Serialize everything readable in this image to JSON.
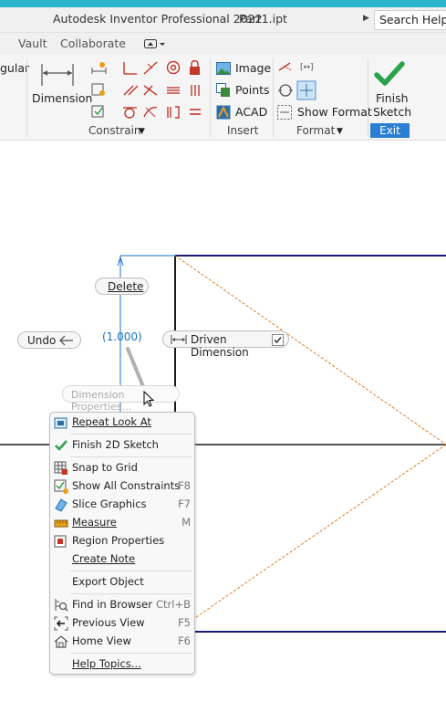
{
  "window": {
    "app_title": "Autodesk Inventor Professional 2022",
    "file_name": "Part1.ipt",
    "search_text": "Search Help &"
  },
  "tabs": [
    "Vault",
    "Collaborate"
  ],
  "ribbon": {
    "partial_label": "gular",
    "dimension_label": "Dimension",
    "constrain_label": "Constrain",
    "insert": {
      "image": "Image",
      "points": "Points",
      "acad": "ACAD",
      "label": "Insert"
    },
    "format": {
      "show_format": "Show Format",
      "label": "Format"
    },
    "exit": {
      "finish_line1": "Finish",
      "finish_line2": "Sketch",
      "label": "Exit"
    }
  },
  "canvas": {
    "delete_label": "Delete",
    "undo_label": "Undo",
    "dimension_value": "(1.000)",
    "driven_dimension_label": "Driven Dimension",
    "dimension_properties_label": "Dimension Properties...",
    "colors": {
      "accent": "#1a73c8",
      "sketch_line": "#1a1a1a",
      "geometry": "#1a1a7a",
      "construction": "#e07b1a"
    }
  },
  "context_menu": {
    "items": [
      {
        "label": "Repeat Look At",
        "shortcut": "",
        "icon": "look-at-icon"
      },
      {
        "label": "Finish 2D Sketch",
        "shortcut": "",
        "icon": "checkmark-icon"
      },
      {
        "label": "Snap to Grid",
        "shortcut": "",
        "icon": "grid-icon"
      },
      {
        "label": "Show All Constraints",
        "shortcut": "F8",
        "icon": "constraints-icon"
      },
      {
        "label": "Slice Graphics",
        "shortcut": "F7",
        "icon": "slice-icon"
      },
      {
        "label": "Measure",
        "shortcut": "M",
        "icon": "ruler-icon"
      },
      {
        "label": "Region Properties",
        "shortcut": "",
        "icon": "region-properties-icon"
      },
      {
        "label": "Create Note",
        "shortcut": "",
        "icon": ""
      },
      {
        "label": "Export Object",
        "shortcut": "",
        "icon": ""
      },
      {
        "label": "Find in Browser",
        "shortcut": "Ctrl+B",
        "icon": "find-browser-icon"
      },
      {
        "label": "Previous View",
        "shortcut": "F5",
        "icon": "previous-view-icon"
      },
      {
        "label": "Home View",
        "shortcut": "F6",
        "icon": "home-icon"
      },
      {
        "label": "Help Topics...",
        "shortcut": "",
        "icon": ""
      }
    ]
  }
}
